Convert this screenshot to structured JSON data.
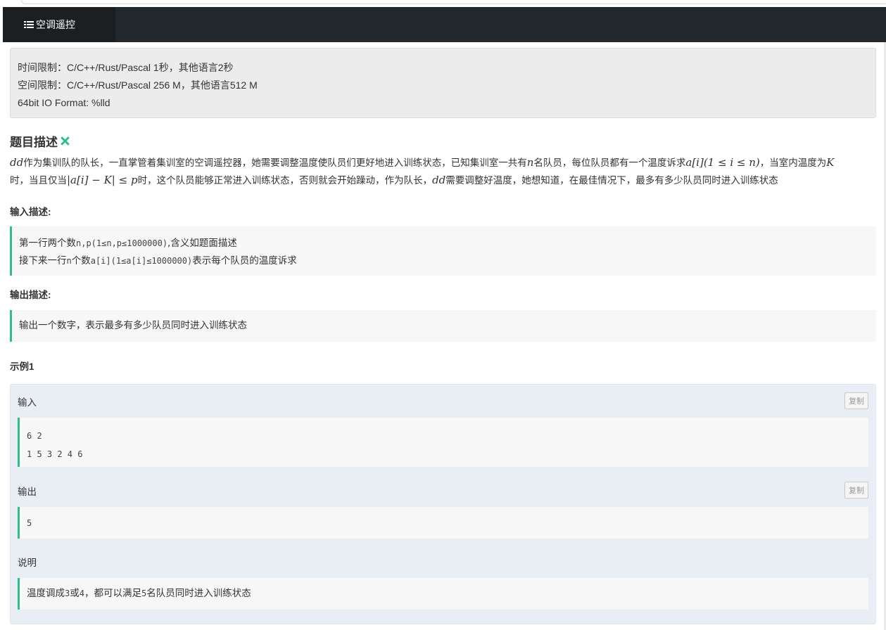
{
  "tab": {
    "label": "空调遥控"
  },
  "limits": {
    "time": "时间限制：C/C++/Rust/Pascal 1秒，其他语言2秒",
    "space": "空间限制：C/C++/Rust/Pascal 256 M，其他语言512 M",
    "format": "64bit IO Format: %lld"
  },
  "problem": {
    "title": "题目描述",
    "desc": {
      "m_dd1": "dd",
      "t1": "作为集训队的队长，一直掌管着集训室的空调遥控器，她需要调整温度使队员们更好地进入训练状态，已知集训室一共有",
      "m_n": "n",
      "t2": "名队员，每位队员都有一个温度诉求",
      "m_ai": "a[i](1 ≤ i ≤ n)",
      "t3": "，当室内温度为",
      "m_k": "K",
      "t4": "时，当且仅当",
      "m_abs": "|a[i] − K| ≤ p",
      "t5": "时，这个队员能够正常进入训练状态，否则就会开始躁动，作为队长，",
      "m_dd2": "dd",
      "t6": "需要调整好温度，她想知道，在最佳情况下，最多有多少队员同时进入训练状态"
    }
  },
  "input": {
    "title": "输入描述:",
    "l1a": "第一行两个数",
    "l1b": "n,p(1≤n,p≤1000000)",
    "l1c": ",含义如题面描述",
    "l2a": "接下来一行",
    "l2b": "n",
    "l2c": "个数",
    "l2d": "a[i](1≤a[i]≤1000000)",
    "l2e": "表示每个队员的温度诉求"
  },
  "output": {
    "title": "输出描述:",
    "text": "输出一个数字，表示最多有多少队员同时进入训练状态"
  },
  "example": {
    "title": "示例1",
    "input_label": "输入",
    "output_label": "输出",
    "note_label": "说明",
    "copy": "复制",
    "input_lines": [
      "6 2",
      "1 5 3 2 4 6"
    ],
    "output_text": "5",
    "note": {
      "a": "温度调成",
      "b": "3",
      "c": "或",
      "d": "4",
      "e": "，都可以满足",
      "f": "5",
      "g": "名队员同时进入训练状态"
    }
  }
}
